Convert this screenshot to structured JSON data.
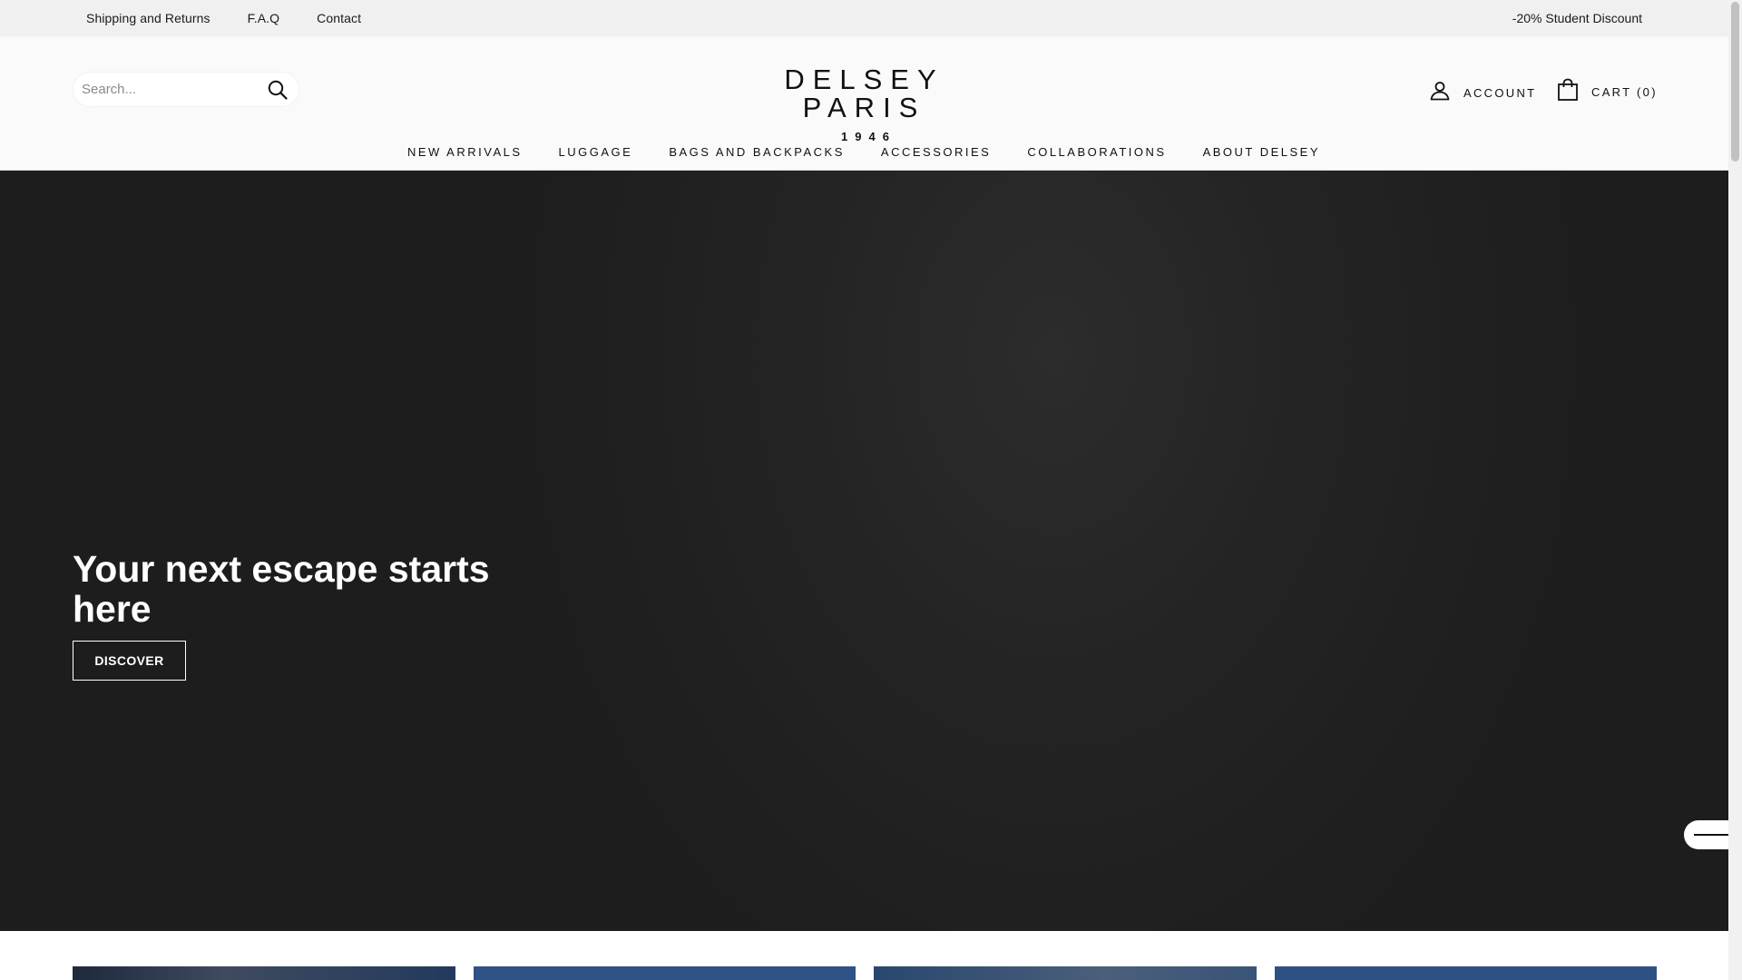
{
  "announcement": {
    "links": [
      "Shipping and Returns",
      "F.A.Q",
      "Contact"
    ],
    "promo": "-20% Student Discount"
  },
  "header": {
    "search": {
      "placeholder": "Search..."
    },
    "logo": {
      "main": "DELSEY PARIS",
      "year": "1946"
    },
    "account_label": "ACCOUNT",
    "cart_label": "CART (0)"
  },
  "nav": {
    "items": [
      "NEW ARRIVALS",
      "LUGGAGE",
      "BAGS AND BACKPACKS",
      "ACCESSORIES",
      "COLLABORATIONS",
      "ABOUT DELSEY"
    ]
  },
  "hero": {
    "title": "Your next escape starts here",
    "button": "DISCOVER"
  },
  "icons": [
    "search-icon",
    "user-icon",
    "shopping-bag-icon",
    "menu-line-icon"
  ],
  "colors": {
    "announcement_bg": "#eff0ef",
    "header_bg": "#fafafa",
    "hero_bg": "#222222",
    "card_blue": "#2f5287"
  }
}
